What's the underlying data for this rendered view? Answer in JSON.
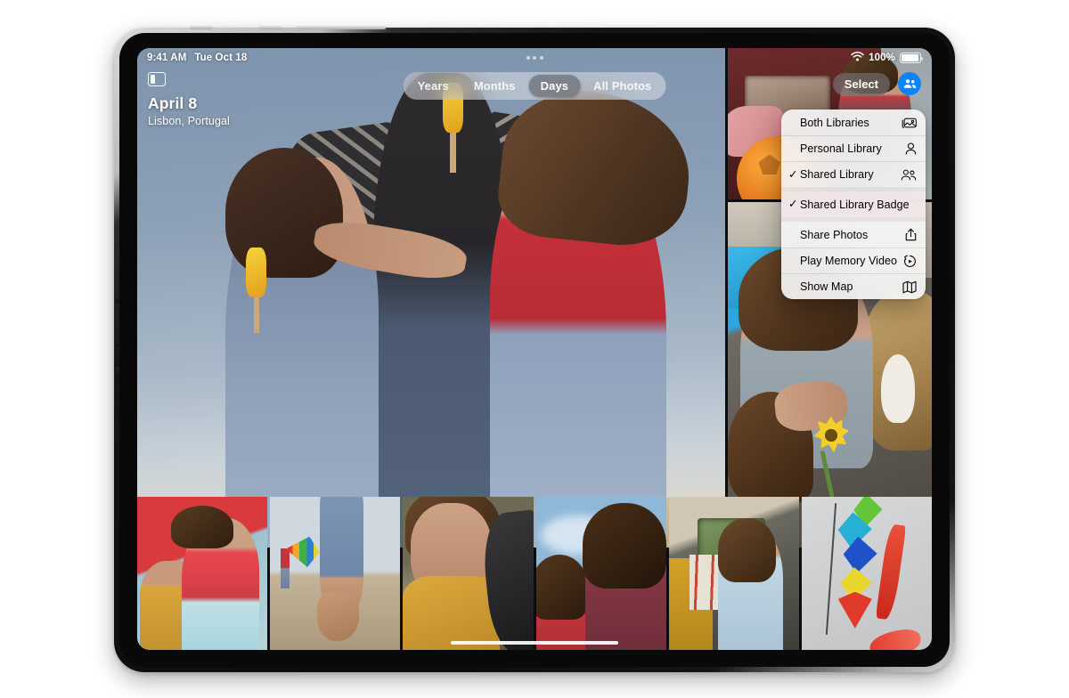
{
  "status_bar": {
    "time": "9:41 AM",
    "date": "Tue Oct 18",
    "battery_percent": "100%",
    "wifi_icon": "wifi-icon",
    "battery_icon": "battery-icon",
    "multitask_handle_icon": "multitasking-dots-icon"
  },
  "header": {
    "sidebar_toggle_icon": "sidebar-toggle-icon",
    "title": "April 8",
    "subtitle": "Lisbon, Portugal",
    "select_label": "Select",
    "shared_library_chip_icon": "shared-library-people-icon"
  },
  "segmented_control": {
    "options": [
      {
        "label": "Years",
        "active": false
      },
      {
        "label": "Months",
        "active": false
      },
      {
        "label": "Days",
        "active": true
      },
      {
        "label": "All Photos",
        "active": false
      }
    ]
  },
  "context_menu": {
    "groups": [
      {
        "highlighted": false,
        "items": [
          {
            "label": "Both Libraries",
            "checked": false,
            "icon": "photo-stack-icon"
          },
          {
            "label": "Personal Library",
            "checked": false,
            "icon": "person-icon"
          },
          {
            "label": "Shared Library",
            "checked": true,
            "icon": "two-people-icon"
          }
        ]
      },
      {
        "highlighted": true,
        "items": [
          {
            "label": "Shared Library Badge",
            "checked": true,
            "icon": ""
          }
        ]
      },
      {
        "highlighted": false,
        "items": [
          {
            "label": "Share Photos",
            "checked": false,
            "icon": "share-icon"
          },
          {
            "label": "Play Memory Video",
            "checked": false,
            "icon": "memory-video-icon"
          },
          {
            "label": "Show Map",
            "checked": false,
            "icon": "map-icon"
          }
        ]
      }
    ]
  },
  "photos": {
    "hero": {
      "name": "photo-father-and-daughters-with-popsicles"
    },
    "top_right": {
      "name": "photo-girl-with-football-by-van"
    },
    "mid_right": {
      "name": "photo-girls-with-sunflower-and-dog"
    },
    "thumbnails": [
      {
        "name": "photo-two-girls-lying-down"
      },
      {
        "name": "photo-legs-on-beach-with-kite"
      },
      {
        "name": "photo-girl-resting-on-car-door"
      },
      {
        "name": "photo-two-girls-in-wind"
      },
      {
        "name": "photo-girl-looking-out-van-window"
      },
      {
        "name": "photo-colorful-kite"
      }
    ]
  },
  "colors": {
    "accent_blue": "#0a84ff",
    "menu_background": "#f6f6f6",
    "menu_highlight": "#eedfe1",
    "segment_active": "#787d86"
  },
  "home_indicator": {
    "name": "home-indicator"
  }
}
